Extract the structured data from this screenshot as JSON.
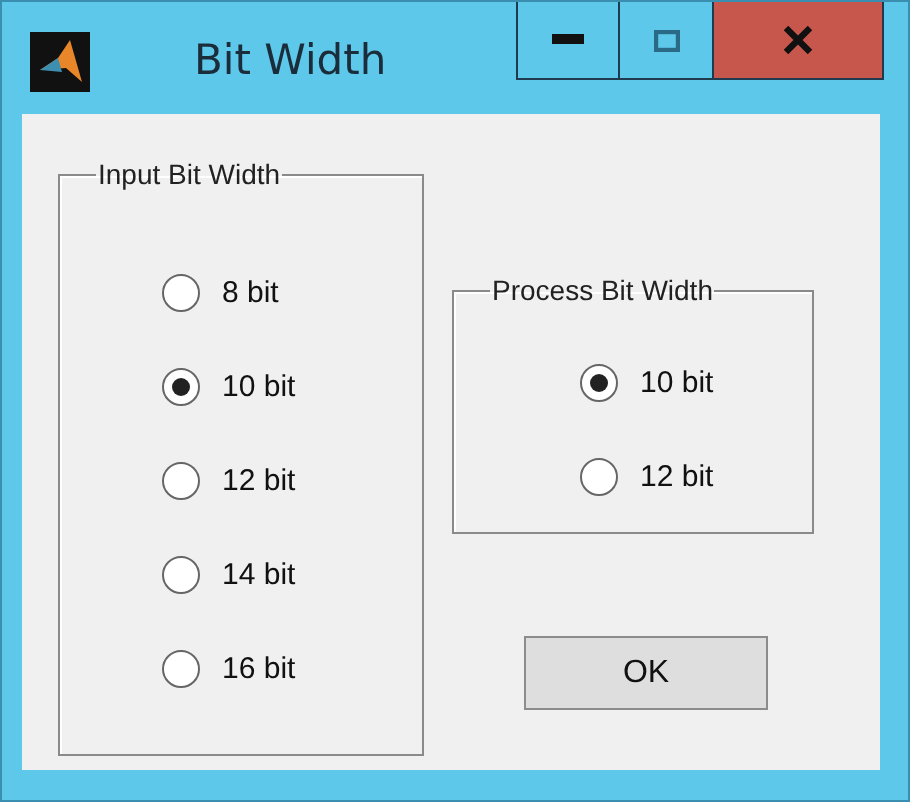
{
  "window": {
    "title": "Bit Width"
  },
  "input_group": {
    "title": "Input Bit Width",
    "options": [
      {
        "label": "8 bit",
        "selected": false
      },
      {
        "label": "10 bit",
        "selected": true
      },
      {
        "label": "12 bit",
        "selected": false
      },
      {
        "label": "14 bit",
        "selected": false
      },
      {
        "label": "16 bit",
        "selected": false
      }
    ]
  },
  "process_group": {
    "title": "Process Bit Width",
    "options": [
      {
        "label": "10 bit",
        "selected": true
      },
      {
        "label": "12 bit",
        "selected": false
      }
    ]
  },
  "buttons": [
    "OK"
  ]
}
